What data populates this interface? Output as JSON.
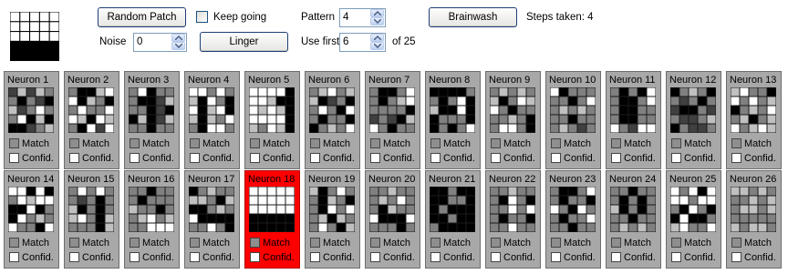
{
  "controls": {
    "random_patch_label": "Random Patch",
    "keep_going_label": "Keep going",
    "keep_going_checked": false,
    "pattern_label": "Pattern",
    "pattern_value": "4",
    "brainwash_label": "Brainwash",
    "steps_text": "Steps taken: 4",
    "noise_label": "Noise",
    "noise_value": "0",
    "linger_label": "Linger",
    "use_first_label": "Use first",
    "use_first_value": "6",
    "of_total_label": "of 25"
  },
  "input_pattern": [
    [
      1,
      1,
      1,
      1,
      1
    ],
    [
      1,
      1,
      1,
      1,
      1
    ],
    [
      1,
      1,
      1,
      1,
      1
    ],
    [
      0,
      0,
      0,
      0,
      0
    ],
    [
      0,
      0,
      0,
      0,
      0
    ]
  ],
  "colors": {
    "panel": "#a8a8a8",
    "active_panel": "#ff0000",
    "black": "#000000",
    "dark": "#404040",
    "gray": "#808080",
    "light": "#c0c0c0",
    "white": "#ffffff"
  },
  "neuron_cards": {
    "match_label": "Match",
    "confid_label": "Confid.",
    "active_index": 17,
    "neurons": [
      {
        "label": "Neuron 1",
        "grid": [
          [
            1,
            3,
            1,
            3,
            2
          ],
          [
            2,
            0,
            2,
            1,
            0
          ],
          [
            3,
            1,
            2,
            4,
            2
          ],
          [
            2,
            4,
            0,
            3,
            0
          ],
          [
            0,
            0,
            1,
            2,
            3
          ]
        ]
      },
      {
        "label": "Neuron 2",
        "grid": [
          [
            2,
            0,
            0,
            3,
            4
          ],
          [
            4,
            0,
            3,
            2,
            0
          ],
          [
            2,
            4,
            2,
            2,
            4
          ],
          [
            4,
            3,
            0,
            4,
            3
          ],
          [
            2,
            0,
            4,
            1,
            4
          ]
        ]
      },
      {
        "label": "Neuron 3",
        "grid": [
          [
            2,
            4,
            0,
            2,
            2
          ],
          [
            2,
            0,
            0,
            1,
            3
          ],
          [
            2,
            2,
            0,
            1,
            0
          ],
          [
            0,
            3,
            0,
            1,
            3
          ],
          [
            2,
            2,
            0,
            2,
            2
          ]
        ]
      },
      {
        "label": "Neuron 4",
        "grid": [
          [
            4,
            4,
            2,
            4,
            2
          ],
          [
            3,
            0,
            4,
            2,
            0
          ],
          [
            4,
            0,
            3,
            4,
            0
          ],
          [
            3,
            0,
            3,
            2,
            4
          ],
          [
            2,
            0,
            4,
            4,
            2
          ]
        ]
      },
      {
        "label": "Neuron 5",
        "grid": [
          [
            4,
            4,
            4,
            4,
            0
          ],
          [
            4,
            4,
            3,
            0,
            0
          ],
          [
            4,
            3,
            4,
            3,
            0
          ],
          [
            4,
            4,
            4,
            4,
            0
          ],
          [
            3,
            2,
            4,
            3,
            0
          ]
        ]
      },
      {
        "label": "Neuron 6",
        "grid": [
          [
            2,
            3,
            4,
            2,
            3
          ],
          [
            3,
            0,
            1,
            2,
            0
          ],
          [
            2,
            4,
            2,
            0,
            4
          ],
          [
            2,
            0,
            2,
            2,
            0
          ],
          [
            0,
            2,
            3,
            2,
            4
          ]
        ]
      },
      {
        "label": "Neuron 7",
        "grid": [
          [
            2,
            0,
            0,
            2,
            4
          ],
          [
            2,
            0,
            2,
            3,
            4
          ],
          [
            2,
            2,
            2,
            2,
            0
          ],
          [
            1,
            2,
            1,
            0,
            3
          ],
          [
            4,
            2,
            0,
            2,
            2
          ]
        ]
      },
      {
        "label": "Neuron 8",
        "grid": [
          [
            0,
            0,
            0,
            0,
            2
          ],
          [
            2,
            0,
            2,
            4,
            0
          ],
          [
            3,
            0,
            0,
            4,
            0
          ],
          [
            0,
            2,
            2,
            2,
            0
          ],
          [
            0,
            2,
            0,
            2,
            4
          ]
        ]
      },
      {
        "label": "Neuron 9",
        "grid": [
          [
            2,
            3,
            2,
            3,
            2
          ],
          [
            3,
            0,
            2,
            4,
            3
          ],
          [
            4,
            2,
            0,
            2,
            2
          ],
          [
            2,
            2,
            3,
            2,
            0
          ],
          [
            2,
            4,
            4,
            2,
            0
          ]
        ]
      },
      {
        "label": "Neuron 10",
        "grid": [
          [
            4,
            0,
            2,
            2,
            2
          ],
          [
            2,
            2,
            0,
            2,
            4
          ],
          [
            2,
            3,
            2,
            3,
            2
          ],
          [
            2,
            2,
            0,
            2,
            2
          ],
          [
            2,
            3,
            2,
            1,
            2
          ]
        ]
      },
      {
        "label": "Neuron 11",
        "grid": [
          [
            2,
            0,
            2,
            0,
            4
          ],
          [
            2,
            0,
            0,
            2,
            4
          ],
          [
            2,
            0,
            0,
            2,
            2
          ],
          [
            2,
            0,
            0,
            2,
            2
          ],
          [
            4,
            2,
            1,
            4,
            4
          ]
        ]
      },
      {
        "label": "Neuron 12",
        "grid": [
          [
            0,
            2,
            3,
            2,
            0
          ],
          [
            2,
            1,
            2,
            0,
            2
          ],
          [
            1,
            0,
            0,
            2,
            1
          ],
          [
            2,
            1,
            1,
            2,
            3
          ],
          [
            0,
            2,
            1,
            1,
            2
          ]
        ]
      },
      {
        "label": "Neuron 13",
        "grid": [
          [
            3,
            4,
            2,
            2,
            0
          ],
          [
            4,
            2,
            4,
            2,
            3
          ],
          [
            0,
            2,
            3,
            2,
            4
          ],
          [
            2,
            3,
            0,
            2,
            3
          ],
          [
            4,
            2,
            3,
            4,
            3
          ]
        ]
      },
      {
        "label": "Neuron 14",
        "grid": [
          [
            4,
            4,
            0,
            4,
            0
          ],
          [
            2,
            4,
            3,
            4,
            4
          ],
          [
            0,
            0,
            4,
            0,
            2
          ],
          [
            0,
            4,
            2,
            3,
            2
          ],
          [
            4,
            2,
            2,
            0,
            4
          ]
        ]
      },
      {
        "label": "Neuron 15",
        "grid": [
          [
            2,
            4,
            2,
            4,
            2
          ],
          [
            2,
            1,
            2,
            0,
            2
          ],
          [
            3,
            0,
            2,
            0,
            2
          ],
          [
            3,
            4,
            2,
            0,
            3
          ],
          [
            2,
            2,
            2,
            0,
            3
          ]
        ]
      },
      {
        "label": "Neuron 16",
        "grid": [
          [
            2,
            2,
            0,
            2,
            2
          ],
          [
            2,
            0,
            2,
            2,
            2
          ],
          [
            3,
            2,
            2,
            0,
            2
          ],
          [
            2,
            3,
            4,
            2,
            3
          ],
          [
            2,
            2,
            4,
            4,
            4
          ]
        ]
      },
      {
        "label": "Neuron 17",
        "grid": [
          [
            0,
            2,
            3,
            2,
            2
          ],
          [
            3,
            3,
            2,
            0,
            3
          ],
          [
            0,
            0,
            2,
            3,
            2
          ],
          [
            4,
            0,
            0,
            0,
            0
          ],
          [
            2,
            2,
            4,
            2,
            0
          ]
        ]
      },
      {
        "label": "Neuron 18",
        "grid": [
          [
            4,
            4,
            4,
            4,
            4
          ],
          [
            4,
            4,
            4,
            4,
            4
          ],
          [
            4,
            4,
            4,
            4,
            4
          ],
          [
            0,
            0,
            0,
            0,
            0
          ],
          [
            0,
            0,
            0,
            0,
            0
          ]
        ]
      },
      {
        "label": "Neuron 19",
        "grid": [
          [
            3,
            0,
            2,
            4,
            2
          ],
          [
            2,
            0,
            3,
            2,
            0
          ],
          [
            2,
            0,
            4,
            2,
            4
          ],
          [
            2,
            3,
            0,
            3,
            2
          ],
          [
            2,
            4,
            2,
            0,
            3
          ]
        ]
      },
      {
        "label": "Neuron 20",
        "grid": [
          [
            2,
            2,
            3,
            2,
            2
          ],
          [
            2,
            3,
            2,
            4,
            2
          ],
          [
            2,
            0,
            3,
            2,
            2
          ],
          [
            4,
            0,
            0,
            0,
            4
          ],
          [
            2,
            2,
            2,
            0,
            2
          ]
        ]
      },
      {
        "label": "Neuron 21",
        "grid": [
          [
            0,
            0,
            2,
            0,
            0
          ],
          [
            0,
            0,
            2,
            2,
            0
          ],
          [
            0,
            2,
            0,
            0,
            0
          ],
          [
            0,
            0,
            2,
            0,
            0
          ],
          [
            2,
            0,
            0,
            0,
            0
          ]
        ]
      },
      {
        "label": "Neuron 22",
        "grid": [
          [
            2,
            2,
            3,
            2,
            2
          ],
          [
            2,
            0,
            4,
            2,
            0
          ],
          [
            2,
            2,
            4,
            2,
            4
          ],
          [
            2,
            0,
            2,
            2,
            0
          ],
          [
            2,
            2,
            4,
            2,
            2
          ]
        ]
      },
      {
        "label": "Neuron 23",
        "grid": [
          [
            2,
            0,
            0,
            2,
            4
          ],
          [
            2,
            0,
            2,
            2,
            0
          ],
          [
            4,
            2,
            0,
            4,
            2
          ],
          [
            2,
            0,
            2,
            2,
            4
          ],
          [
            2,
            2,
            0,
            2,
            2
          ]
        ]
      },
      {
        "label": "Neuron 24",
        "grid": [
          [
            2,
            2,
            0,
            2,
            2
          ],
          [
            2,
            0,
            2,
            0,
            2
          ],
          [
            3,
            0,
            2,
            0,
            2
          ],
          [
            2,
            2,
            0,
            2,
            2
          ],
          [
            2,
            3,
            2,
            3,
            2
          ]
        ]
      },
      {
        "label": "Neuron 25",
        "grid": [
          [
            4,
            2,
            4,
            0,
            4
          ],
          [
            4,
            4,
            2,
            4,
            4
          ],
          [
            2,
            0,
            4,
            2,
            0
          ],
          [
            0,
            4,
            0,
            0,
            2
          ],
          [
            3,
            4,
            2,
            2,
            4
          ]
        ]
      },
      {
        "label": "Neuron 26",
        "grid": [
          [
            3,
            3,
            2,
            3,
            2
          ],
          [
            2,
            2,
            3,
            2,
            3
          ],
          [
            2,
            3,
            3,
            2,
            3
          ],
          [
            2,
            2,
            2,
            2,
            2
          ],
          [
            3,
            2,
            3,
            3,
            2
          ]
        ]
      }
    ]
  }
}
